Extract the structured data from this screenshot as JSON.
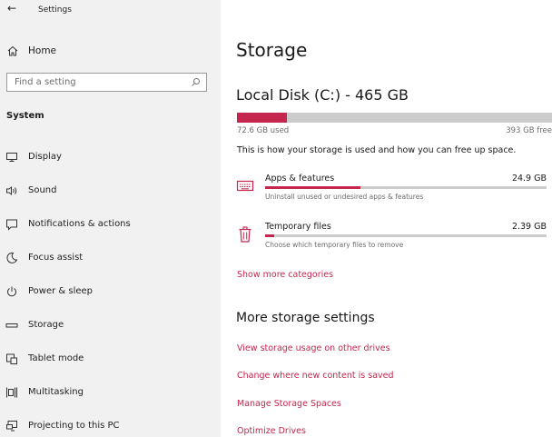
{
  "window": {
    "title": "Settings",
    "back_icon": "back-arrow-icon"
  },
  "sidebar": {
    "home": {
      "label": "Home",
      "icon": "home-icon"
    },
    "search": {
      "placeholder": "Find a setting",
      "icon": "search-icon"
    },
    "group_header": "System",
    "items": [
      {
        "label": "Display",
        "icon": "display-icon"
      },
      {
        "label": "Sound",
        "icon": "speaker-icon"
      },
      {
        "label": "Notifications & actions",
        "icon": "notification-icon"
      },
      {
        "label": "Focus assist",
        "icon": "moon-icon"
      },
      {
        "label": "Power & sleep",
        "icon": "power-icon"
      },
      {
        "label": "Storage",
        "icon": "storage-icon"
      },
      {
        "label": "Tablet mode",
        "icon": "tablet-icon"
      },
      {
        "label": "Multitasking",
        "icon": "multitasking-icon"
      },
      {
        "label": "Projecting to this PC",
        "icon": "projecting-icon"
      }
    ]
  },
  "main": {
    "title": "Storage",
    "disk": {
      "name": "Local Disk (C:) - 465 GB",
      "used_label": "72.6 GB used",
      "free_label": "393 GB free",
      "used_fraction": 0.156
    },
    "intro": "This is how your storage is used and how you can free up space.",
    "categories": [
      {
        "name": "Apps & features",
        "size": "24.9 GB",
        "description": "Uninstall unused or undesired apps & features",
        "usage_fraction": 0.34,
        "icon": "keyboard-icon"
      },
      {
        "name": "Temporary files",
        "size": "2.39 GB",
        "description": "Choose which temporary files to remove",
        "usage_fraction": 0.033,
        "icon": "trash-icon"
      }
    ],
    "show_more": "Show more categories",
    "more_section": {
      "title": "More storage settings",
      "links": [
        "View storage usage on other drives",
        "Change where new content is saved",
        "Manage Storage Spaces",
        "Optimize Drives"
      ]
    }
  },
  "colors": {
    "accent": "#c4264d",
    "sidebar_bg": "#f1f1f1",
    "bar_bg": "#cccccc",
    "secondary_text": "#6d6d6d"
  }
}
